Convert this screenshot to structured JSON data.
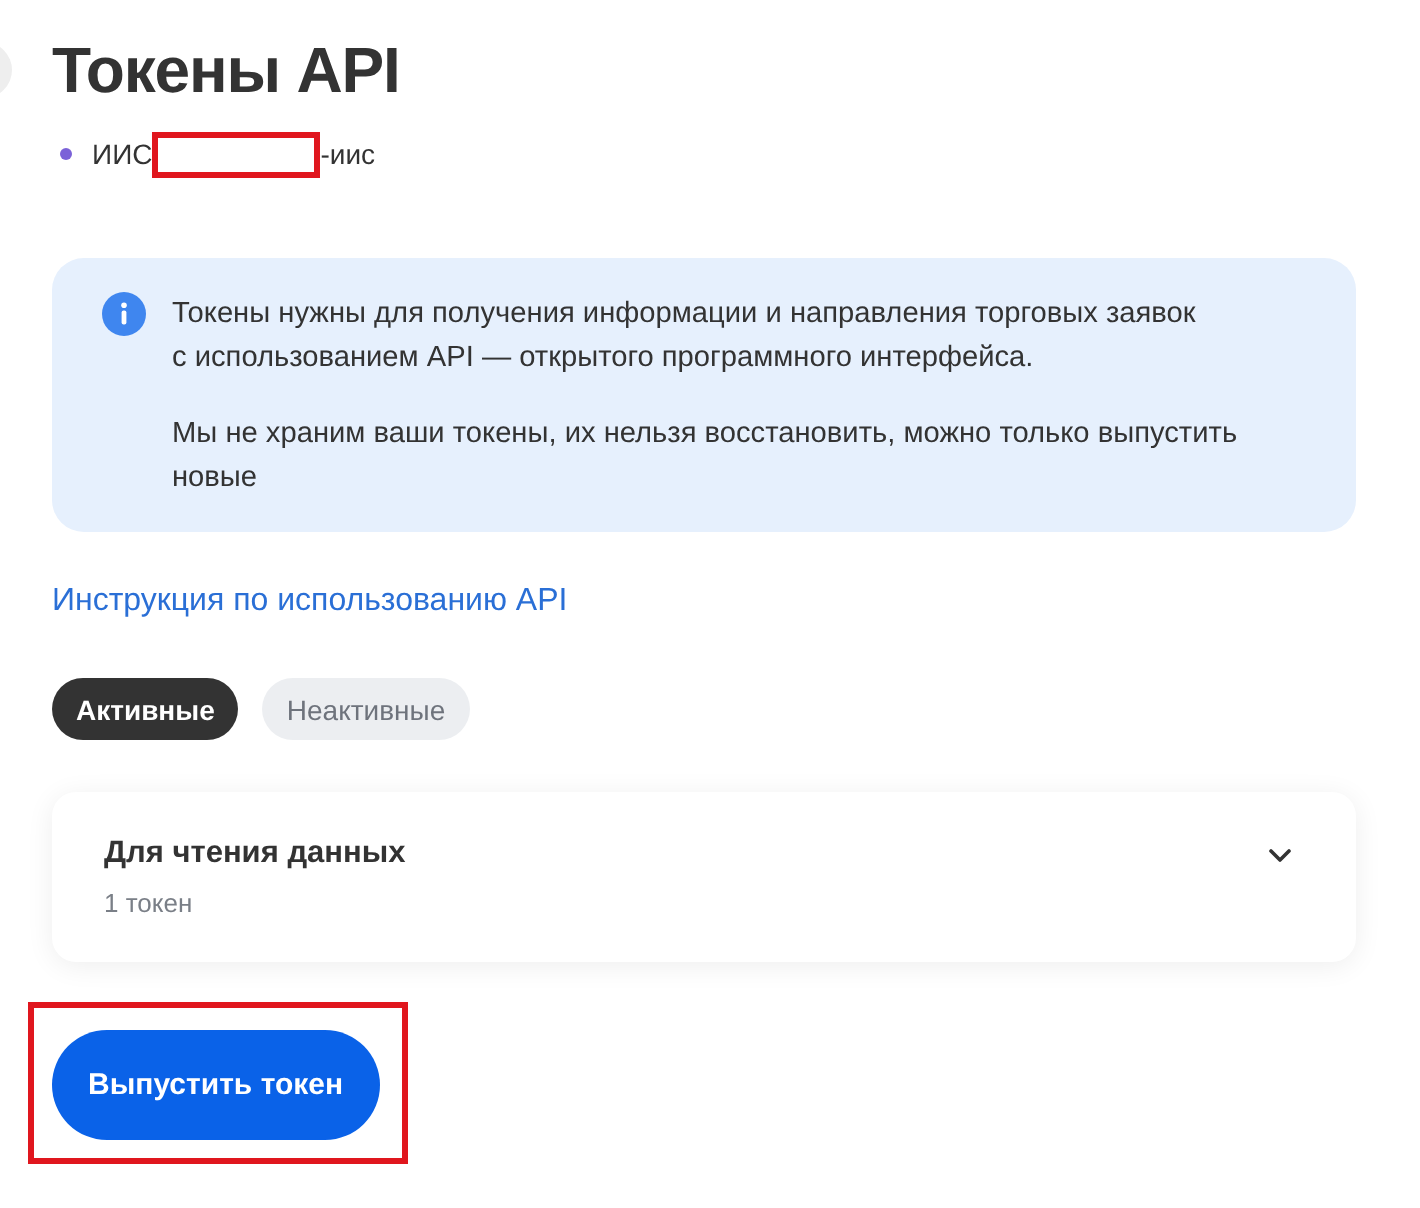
{
  "page": {
    "title": "Токены API"
  },
  "account": {
    "name_start": "ИИС",
    "name_end": "-иис",
    "redacted": true
  },
  "info": {
    "paragraphs": [
      "Токены нужны для получения информации и направления торговых заявок с использованием API — открытого программного интерфейса.",
      "Мы не храним ваши токены, их нельзя восстановить, можно только выпустить новые"
    ]
  },
  "help_link": "Инструкция по использованию API",
  "tabs": [
    {
      "label": "Активные",
      "selected": true
    },
    {
      "label": "Неактивные",
      "selected": false
    }
  ],
  "token_groups": [
    {
      "title": "Для чтения данных",
      "count": "1 токен",
      "expanded": false
    }
  ],
  "issue_button": {
    "label": "Выпустить токен",
    "highlighted": true
  }
}
